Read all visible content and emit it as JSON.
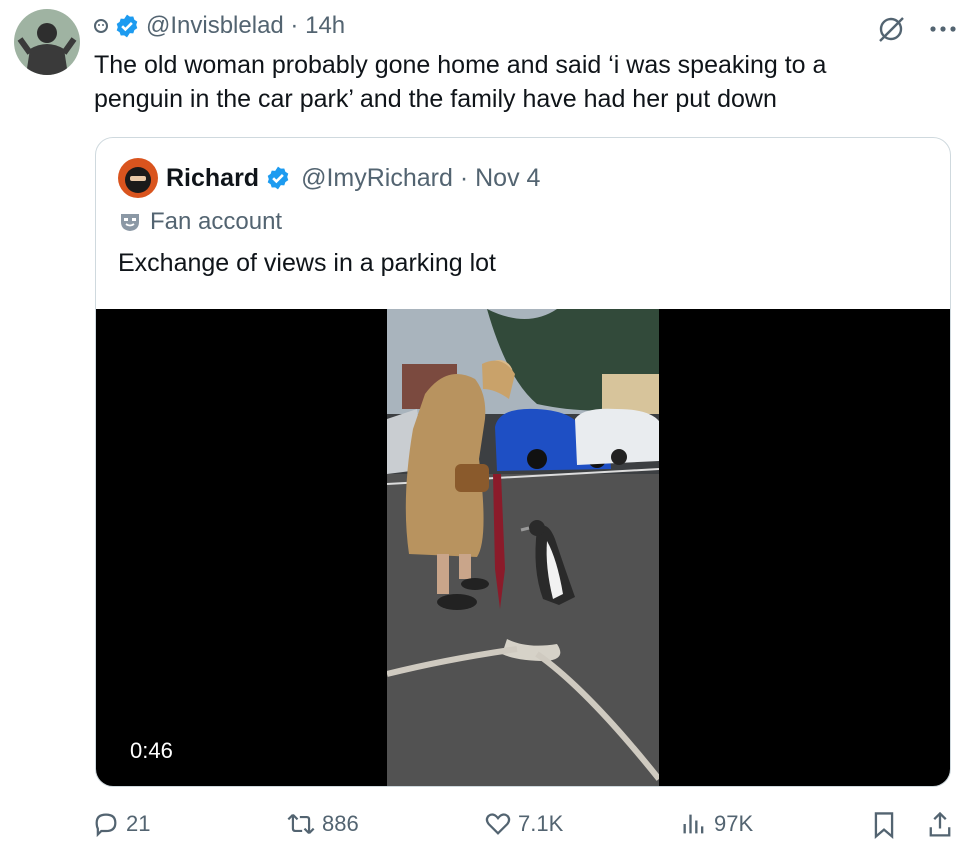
{
  "tweet": {
    "handle": "@Invisblelad",
    "time": "14h",
    "text": "The old woman probably gone home and said ‘i was speaking to a penguin in the car park’ and the family have had her put down"
  },
  "quote": {
    "name": "Richard",
    "handle": "@ImyRichard",
    "date": "Nov 4",
    "label": "Fan account",
    "text": "Exchange of views in a parking lot",
    "video_duration": "0:46"
  },
  "actions": {
    "replies": "21",
    "retweets": "886",
    "likes": "7.1K",
    "views": "97K"
  },
  "colors": {
    "verified": "#1d9bf0",
    "muted": "#536471",
    "text": "#0f1419",
    "border": "#cfd9de"
  },
  "icons": [
    "reply-icon",
    "retweet-icon",
    "like-icon",
    "views-icon",
    "bookmark-icon",
    "share-icon",
    "grok-icon",
    "more-icon",
    "verified-badge-icon",
    "fan-mask-icon"
  ]
}
